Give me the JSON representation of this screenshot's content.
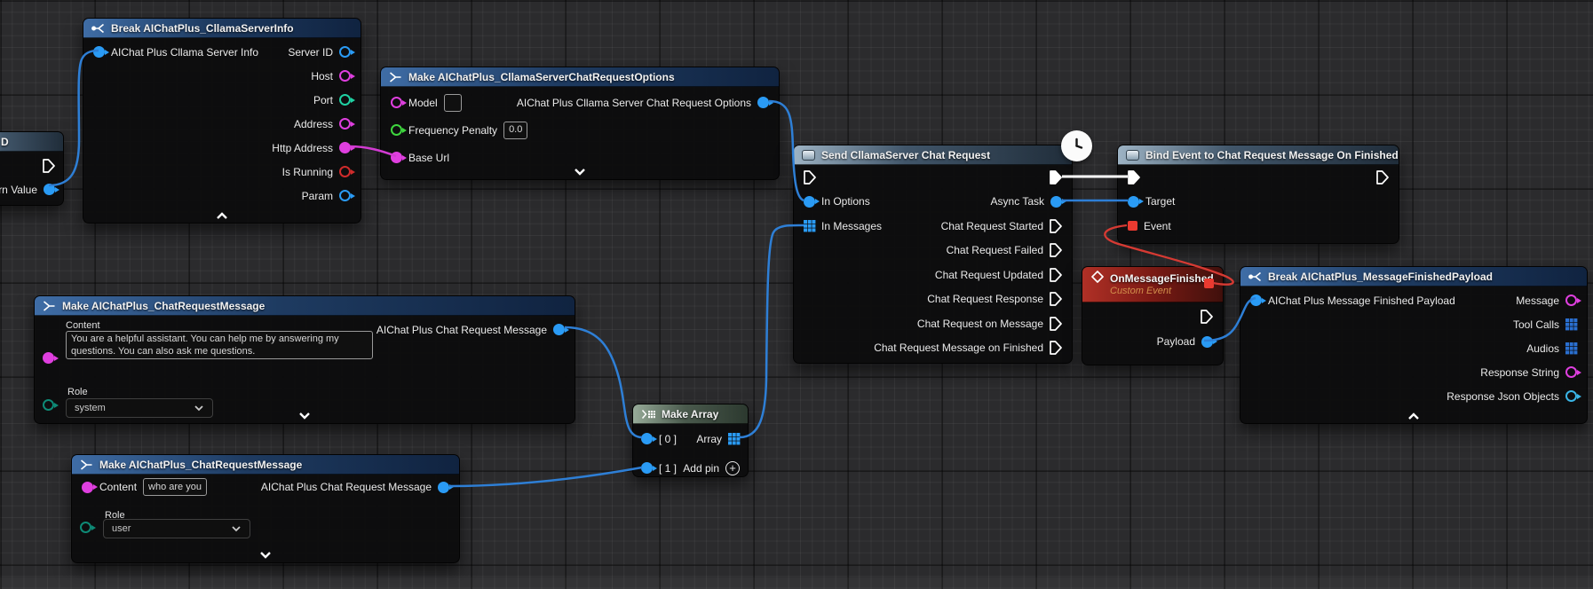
{
  "colors": {
    "exec_wire": "#ffffff",
    "object_pin": "#2a9bf5",
    "string_pin": "#df3fdf",
    "bool_pin": "#cf2b2b",
    "int_pin": "#1fd2a3",
    "float_pin": "#3ed53e",
    "enum_pin": "#0e8a76",
    "json_pin": "#3ab5e6",
    "delegate_pin": "#ea3a30",
    "wire_blue": "#2e7fd6",
    "wire_magenta": "#d23bd2",
    "wire_red": "#d63a33",
    "header_struct_blue": "#3f6da6",
    "header_function_steel": "#9db3c4",
    "header_array_green": "#97ab99",
    "header_event_red": "#b03026"
  },
  "nodes": {
    "left_partial": {
      "title": "D",
      "return_label": "urn Value"
    },
    "break_server_info": {
      "title": "Break AIChatPlus_CllamaServerInfo",
      "input_label": "AIChat Plus Cllama Server Info",
      "outputs": [
        {
          "label": "Server ID"
        },
        {
          "label": "Host"
        },
        {
          "label": "Port"
        },
        {
          "label": "Address"
        },
        {
          "label": "Http Address"
        },
        {
          "label": "Is Running"
        },
        {
          "label": "Param"
        }
      ]
    },
    "make_options": {
      "title": "Make AIChatPlus_CllamaServerChatRequestOptions",
      "model_label": "Model",
      "model_value": "",
      "freq_label": "Frequency Penalty",
      "freq_value": "0.0",
      "baseurl_label": "Base Url",
      "output_label": "AIChat Plus Cllama Server Chat Request Options"
    },
    "send_request": {
      "title": "Send CllamaServer Chat Request",
      "in_options_label": "In Options",
      "in_messages_label": "In Messages",
      "outputs": [
        "Async Task",
        "Chat Request Started",
        "Chat Request Failed",
        "Chat Request Updated",
        "Chat Request Response",
        "Chat Request on Message",
        "Chat Request Message on Finished"
      ]
    },
    "bind_event": {
      "title": "Bind Event to Chat Request Message On Finished",
      "target_label": "Target",
      "event_label": "Event"
    },
    "custom_event": {
      "title": "OnMessageFinished",
      "subtitle": "Custom Event",
      "payload_label": "Payload"
    },
    "break_payload": {
      "title": "Break AIChatPlus_MessageFinishedPayload",
      "input_label": "AIChat Plus Message Finished Payload",
      "outputs": [
        {
          "label": "Message"
        },
        {
          "label": "Tool Calls"
        },
        {
          "label": "Audios"
        },
        {
          "label": "Response String"
        },
        {
          "label": "Response Json Objects"
        }
      ]
    },
    "make_message_system": {
      "title": "Make AIChatPlus_ChatRequestMessage",
      "content_label": "Content",
      "content_value": "You are a helpful assistant. You can help me by answering my questions. You can also ask me questions.",
      "role_label": "Role",
      "role_value": "system",
      "output_label": "AIChat Plus Chat Request Message"
    },
    "make_message_user": {
      "title": "Make AIChatPlus_ChatRequestMessage",
      "content_label": "Content",
      "content_value": "who are you",
      "role_label": "Role",
      "role_value": "user",
      "output_label": "AIChat Plus Chat Request Message"
    },
    "make_array": {
      "title": "Make Array",
      "input0_label": "[ 0 ]",
      "input1_label": "[ 1 ]",
      "array_label": "Array",
      "add_pin_label": "Add pin"
    }
  }
}
